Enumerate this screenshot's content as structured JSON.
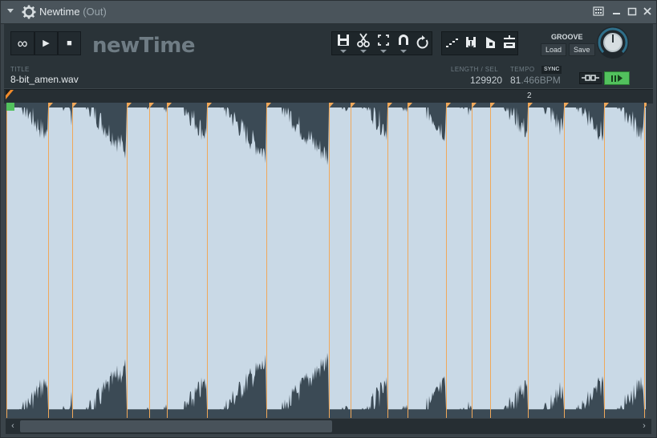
{
  "window": {
    "title": "Newtime",
    "title_suffix": "(Out)",
    "icons": [
      "gear-icon",
      "menu-arrow-icon",
      "view-icon",
      "minimize-icon",
      "maximize-icon",
      "close-icon"
    ]
  },
  "transport": {
    "loop_label": "∞",
    "play_label": "▶",
    "stop_label": "■"
  },
  "logo": "newTime",
  "toolbar_left": [
    "save-icon",
    "cut-icon",
    "select-icon",
    "magnet-icon",
    "reset-icon"
  ],
  "toolbar_right": [
    "slice-icon",
    "export-icon",
    "send-icon",
    "groove-icon"
  ],
  "info": {
    "title_label": "TITLE",
    "title_value": "8-bit_amen.wav",
    "length_label": "LENGTH / SEL",
    "length_value": "129920",
    "tempo_label": "TEMPO",
    "tempo_value_main": "81",
    "tempo_value_fraction": ".466BPM",
    "sync_label": "SYNC"
  },
  "groove": {
    "label": "GROOVE",
    "load_label": "Load",
    "save_label": "Save"
  },
  "ruler": {
    "bar_number": "2"
  },
  "colors": {
    "wave_fill": "#c9d9e6",
    "wave_bg": "#3b4a55",
    "slice_marker": "#f0a85a",
    "play_accent": "#52c15d"
  }
}
